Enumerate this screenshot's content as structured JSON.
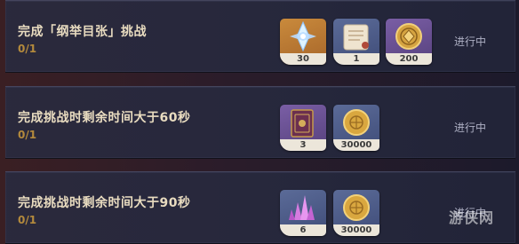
{
  "challenges": [
    {
      "title": "完成「纲举目张」挑战",
      "progress": "0/1",
      "status": "进行中",
      "rewards": [
        {
          "icon": "primogem-icon",
          "count": "30"
        },
        {
          "icon": "scroll-icon",
          "count": "1"
        },
        {
          "icon": "coin-icon",
          "count": "200"
        }
      ]
    },
    {
      "title": "完成挑战时剩余时间大于60秒",
      "progress": "0/1",
      "status": "进行中",
      "rewards": [
        {
          "icon": "book-icon",
          "count": "3"
        },
        {
          "icon": "mora-icon",
          "count": "30000"
        }
      ]
    },
    {
      "title": "完成挑战时剩余时间大于90秒",
      "progress": "0/1",
      "status": "进行中",
      "rewards": [
        {
          "icon": "crystal-icon",
          "count": "6"
        },
        {
          "icon": "mora-icon",
          "count": "30000"
        }
      ]
    }
  ],
  "watermark": "游侠网"
}
